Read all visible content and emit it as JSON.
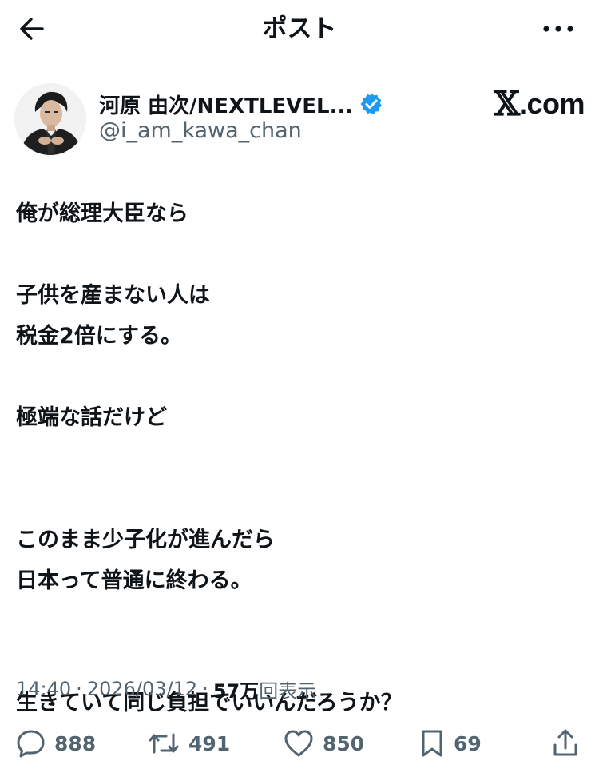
{
  "header": {
    "title": "ポスト",
    "back_icon": "arrow-left-icon",
    "more_icon": "more-horizontal-icon"
  },
  "author": {
    "display_name": "河原 由次/NEXTLEVEL...",
    "handle": "@i_am_kawa_chan",
    "verified": true,
    "verified_color": "#1d9bf0",
    "avatar_icon": "profile-photo"
  },
  "watermark": {
    "x_mark": "𝕏",
    "domain": ".com"
  },
  "tweet": {
    "lines": [
      "俺が総理大臣なら",
      "",
      "子供を産まない人は",
      "税金2倍にする。",
      "",
      "極端な話だけど",
      "",
      "",
      "このまま少子化が進んだら",
      "日本って普通に終わる。",
      "",
      "",
      "生きていて同じ負担でいいんだろうか？"
    ]
  },
  "meta": {
    "time": "14:40",
    "separator": "·",
    "date": "2026/03/12",
    "views_count": "57万",
    "views_label": "回表示"
  },
  "actions": {
    "reply_count": "888",
    "repost_count": "491",
    "like_count": "850",
    "bookmark_count": "69"
  },
  "colors": {
    "text_primary": "#0f1419",
    "text_secondary": "#536471",
    "accent": "#1d9bf0"
  }
}
